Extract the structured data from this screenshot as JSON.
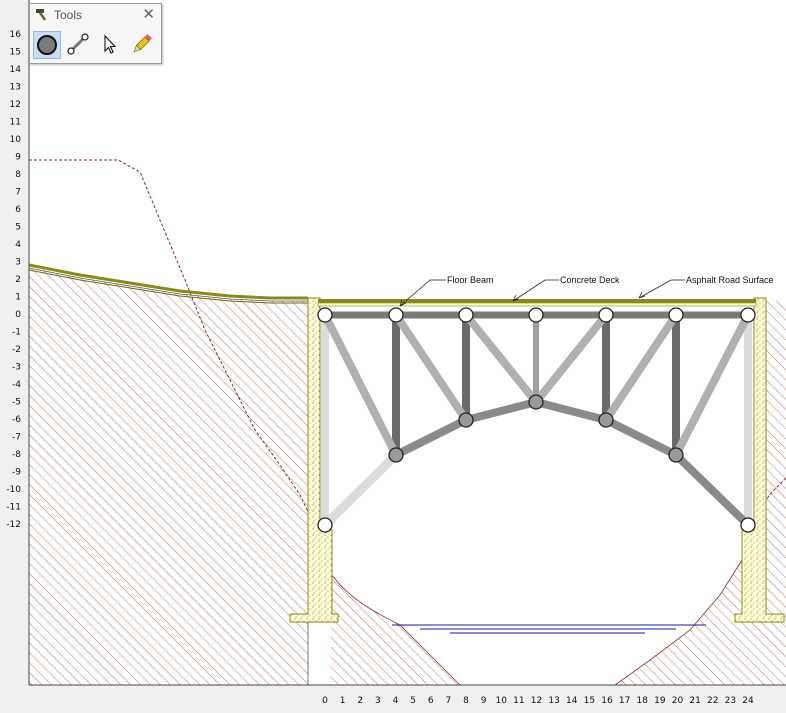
{
  "toolbox": {
    "title": "Tools",
    "close_symbol": "✕",
    "tools": [
      {
        "name": "joint-tool",
        "icon": "circle-icon",
        "selected": true
      },
      {
        "name": "member-tool",
        "icon": "member-link-icon",
        "selected": false
      },
      {
        "name": "select-tool",
        "icon": "cursor-arrow-icon",
        "selected": false
      },
      {
        "name": "edit-tool",
        "icon": "pencil-icon",
        "selected": false
      }
    ]
  },
  "axes": {
    "y_labels": [
      "16",
      "15",
      "14",
      "13",
      "12",
      "11",
      "10",
      "9",
      "8",
      "7",
      "6",
      "5",
      "4",
      "3",
      "2",
      "1",
      "0",
      "-1",
      "-2",
      "-3",
      "-4",
      "-5",
      "-6",
      "-7",
      "-8",
      "-9",
      "-10",
      "-11",
      "-12"
    ],
    "x_labels": [
      "0",
      "1",
      "2",
      "3",
      "4",
      "5",
      "6",
      "7",
      "8",
      "9",
      "10",
      "11",
      "12",
      "13",
      "14",
      "15",
      "16",
      "17",
      "18",
      "19",
      "20",
      "21",
      "22",
      "23",
      "24"
    ]
  },
  "annotations": {
    "floor_beam": "Floor Beam",
    "concrete_deck": "Concrete Deck",
    "asphalt_road": "Asphalt Road Surface"
  },
  "colors": {
    "deck": "#8a8a1a",
    "abutment_fill": "#fbfbd8",
    "hatch": "#b04545",
    "water": "#1a1a9a",
    "joint_fixed": "#ffffff",
    "joint_free": "#9a9a9a"
  }
}
